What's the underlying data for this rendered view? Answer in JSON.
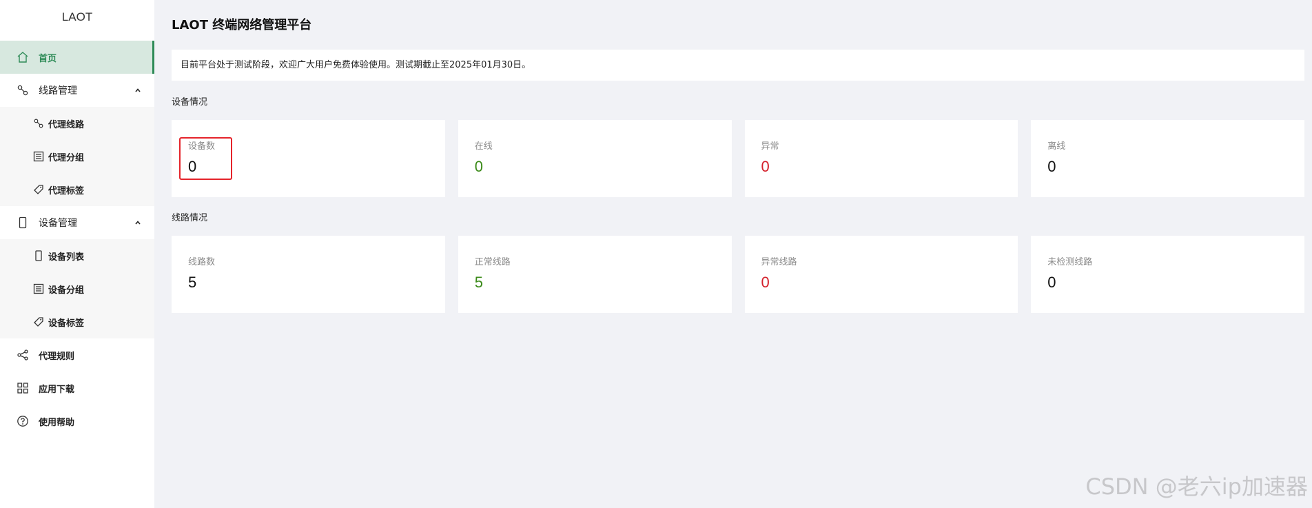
{
  "sidebar": {
    "brand": "LAOT",
    "items": {
      "home": "首页",
      "line_mgmt": "线路管理",
      "proxy_line": "代理线路",
      "proxy_group": "代理分组",
      "proxy_tag": "代理标签",
      "device_mgmt": "设备管理",
      "device_list": "设备列表",
      "device_group": "设备分组",
      "device_tag": "设备标签",
      "proxy_rules": "代理规则",
      "app_download": "应用下载",
      "help": "使用帮助"
    }
  },
  "header": {
    "title": "LAOT 终端网络管理平台"
  },
  "notice": "目前平台处于测试阶段，欢迎广大用户免费体验使用。测试期截止至2025年01月30日。",
  "device_section": {
    "title": "设备情况",
    "cards": [
      {
        "label": "设备数",
        "value": "0"
      },
      {
        "label": "在线",
        "value": "0"
      },
      {
        "label": "异常",
        "value": "0"
      },
      {
        "label": "离线",
        "value": "0"
      }
    ]
  },
  "line_section": {
    "title": "线路情况",
    "cards": [
      {
        "label": "线路数",
        "value": "5"
      },
      {
        "label": "正常线路",
        "value": "5"
      },
      {
        "label": "异常线路",
        "value": "0"
      },
      {
        "label": "未检测线路",
        "value": "0"
      }
    ]
  },
  "colors": {
    "accent": "#2e8b57",
    "active_bg": "#d7e8df",
    "ok": "#3c8b1a",
    "error": "#d4202b",
    "highlight": "#e5232a"
  },
  "watermark": "CSDN @老六ip加速器"
}
